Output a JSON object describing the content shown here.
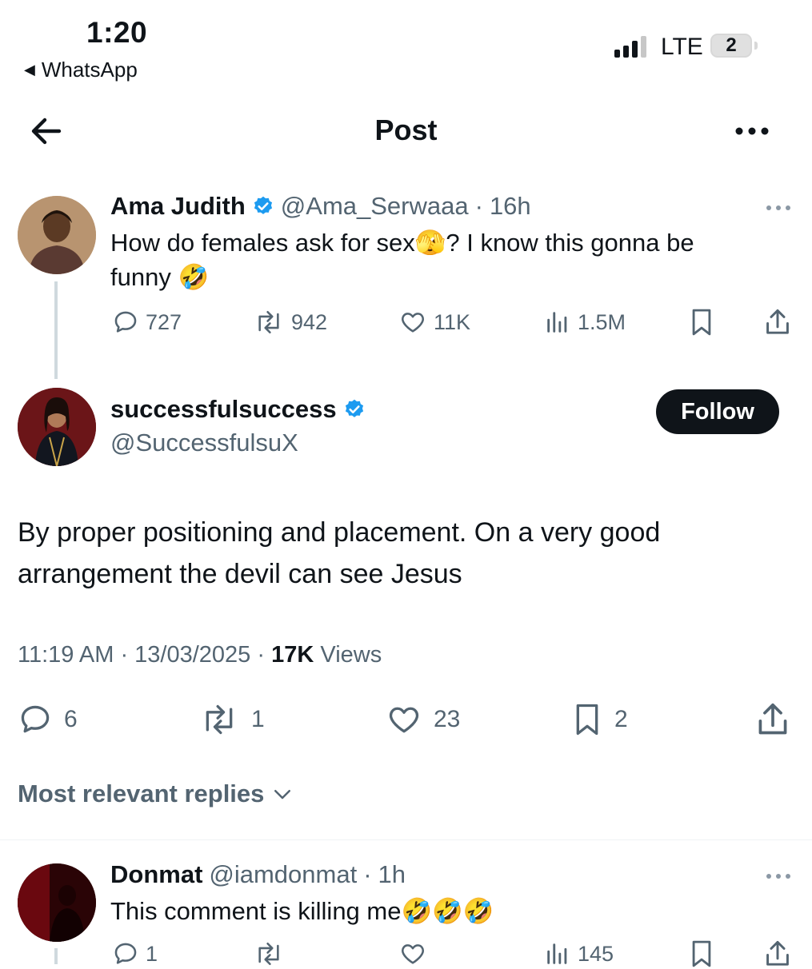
{
  "status_bar": {
    "time": "1:20",
    "back_app": "WhatsApp",
    "network": "LTE",
    "battery": "2"
  },
  "header": {
    "title": "Post"
  },
  "parent_post": {
    "name": "Ama Judith",
    "handle": "@Ama_Serwaaa",
    "age": "16h",
    "text_line1": "How do females ask for sex🫣? I know this gonna be",
    "text_line2": "funny 🤣",
    "replies": "727",
    "reposts": "942",
    "likes": "11K",
    "views": "1.5M"
  },
  "main_post": {
    "name": "successfulsuccess",
    "handle": "@SuccessfulsuX",
    "follow_label": "Follow",
    "text": "By proper positioning and placement. On a very good arrangement the devil can see Jesus",
    "time": "11:19 AM",
    "date": "13/03/2025",
    "views_count": "17K",
    "views_label": "Views",
    "replies": "6",
    "reposts": "1",
    "likes": "23",
    "bookmarks": "2"
  },
  "replies_section": {
    "sort_label": "Most relevant replies"
  },
  "reply": {
    "name": "Donmat",
    "handle": "@iamdonmat",
    "age": "1h",
    "text": "This comment is killing me🤣🤣🤣",
    "replies": "1",
    "views": "145"
  },
  "colors": {
    "verified": "#1d9bf0",
    "text": "#0f1419",
    "secondary": "#536471"
  }
}
